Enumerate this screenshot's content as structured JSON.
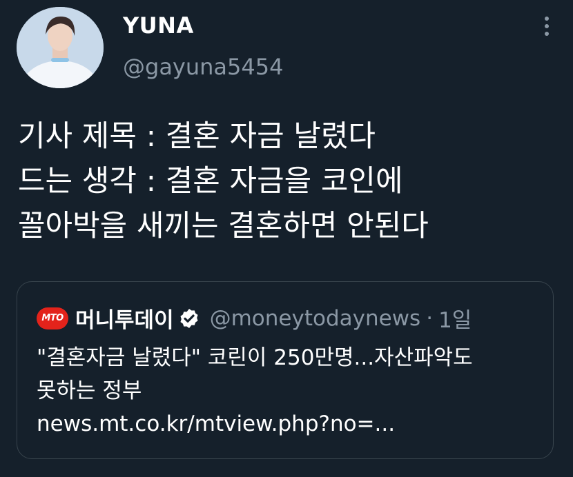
{
  "author": {
    "display_name": "YUNA",
    "handle": "@gayuna5454",
    "avatar": "profile-photo"
  },
  "more_icon": "more-vertical-icon",
  "tweet": {
    "lines": [
      "기사 제목 : 결혼 자금 날렸다",
      "드는 생각 : 결혼 자금을 코인에",
      "꼴아박을 새끼는 결혼하면 안된다"
    ]
  },
  "quoted": {
    "logo_text": "MTO",
    "display_name": "머니투데이",
    "verified_icon": "verified-badge-icon",
    "handle": "@moneytodaynews",
    "separator": "·",
    "time": "1일",
    "text_lines": [
      "\"결혼자금 날렸다\" 코린이 250만명...자산파악도",
      "못하는 정부"
    ],
    "link": "news.mt.co.kr/mtview.php?no=..."
  },
  "colors": {
    "background": "#15202b",
    "secondary_text": "#8b98a5",
    "border": "#38444d",
    "logo_red": "#e3231b"
  }
}
